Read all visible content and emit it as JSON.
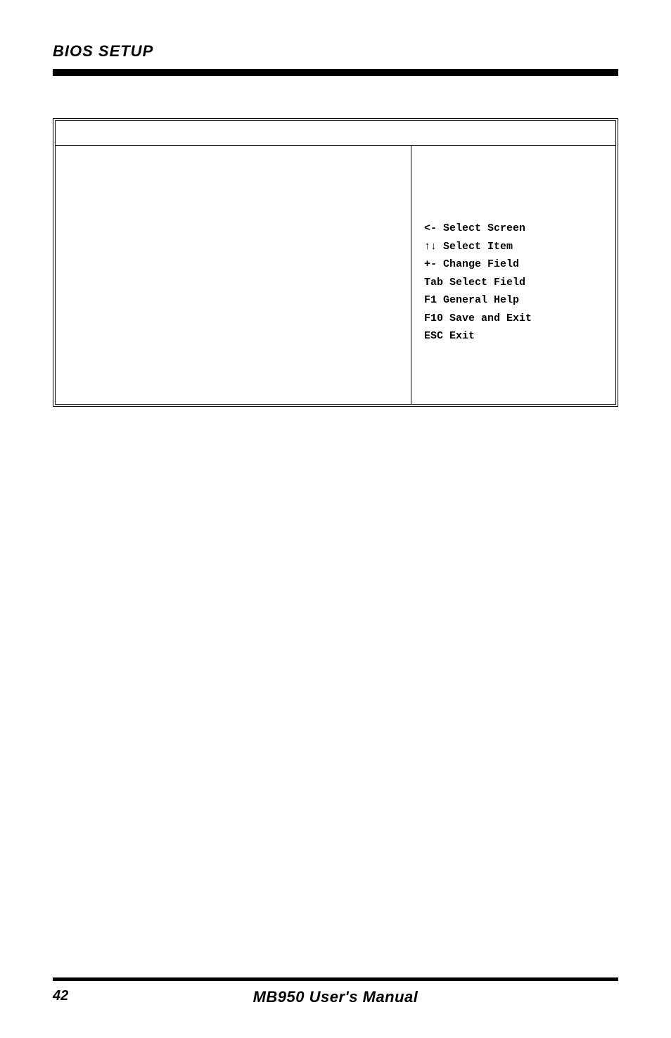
{
  "header": {
    "title": "BIOS SETUP"
  },
  "help_panel": {
    "lines": [
      "<-  Select Screen",
      "↑↓ Select Item",
      "+-  Change Field",
      "Tab Select Field",
      "F1  General Help",
      "F10 Save and Exit",
      "ESC  Exit"
    ]
  },
  "footer": {
    "page_number": "42",
    "manual_title": "MB950 User's Manual"
  }
}
